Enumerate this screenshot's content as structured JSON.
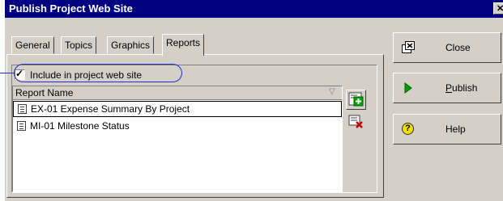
{
  "window": {
    "title": "Publish Project Web Site",
    "close_glyph": "✕"
  },
  "tabs": [
    {
      "label": "General"
    },
    {
      "label": "Topics"
    },
    {
      "label": "Graphics"
    },
    {
      "label": "Reports",
      "active": true
    }
  ],
  "reports": {
    "include_label": "Include in project web site",
    "include_checked": true,
    "check_glyph": "✓",
    "column_header": "Report Name",
    "sort_glyph": "▽",
    "rows": [
      {
        "label": "EX-01  Expense Summary By Project",
        "selected": true
      },
      {
        "label": "MI-01  Milestone Status",
        "selected": false
      }
    ],
    "add_icon": "add-report-icon",
    "delete_icon": "delete-report-icon"
  },
  "buttons": {
    "close": {
      "label": "Close",
      "icon": "close-window-icon"
    },
    "publish": {
      "label_accel": "P",
      "label_rest": "ublish",
      "icon": "play-arrow-icon"
    },
    "help": {
      "label": "Help",
      "icon": "help-icon",
      "glyph": "?"
    }
  },
  "colors": {
    "titlebar": "#000080",
    "face": "#d4d0c8",
    "highlight_ellipse": "#2030d0",
    "publish_arrow": "#00a000",
    "help_icon": "#f0e000",
    "delete_x": "#c00000"
  }
}
